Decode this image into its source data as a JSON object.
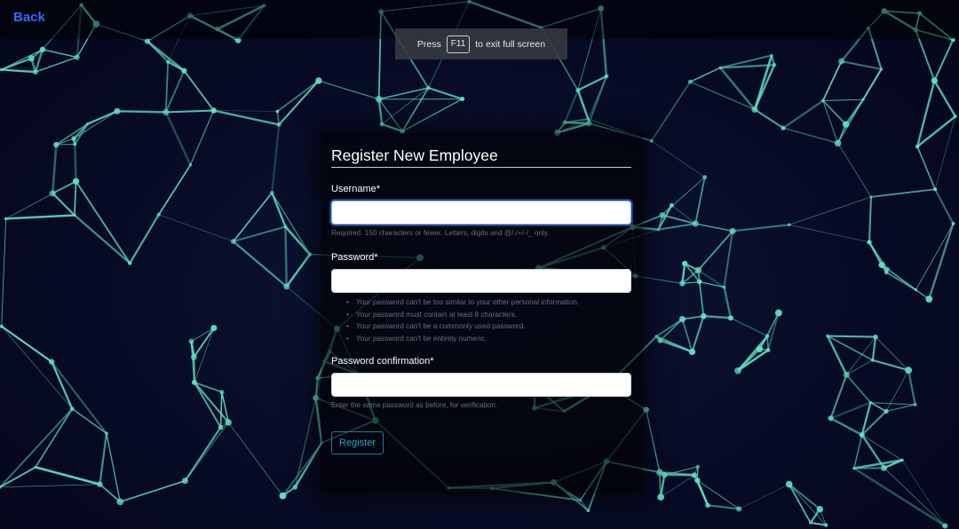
{
  "topbar": {
    "back_label": "Back"
  },
  "fullscreen_notice": {
    "prefix": "Press",
    "key": "F11",
    "suffix": "to exit full screen"
  },
  "form": {
    "title": "Register New Employee",
    "username": {
      "label": "Username*",
      "value": "",
      "help": "Required. 150 characters or fewer. Letters, digits and @/./+/-/_ only."
    },
    "password": {
      "label": "Password*",
      "value": "",
      "help_items": [
        "Your password can't be too similar to your other personal information.",
        "Your password must contain at least 8 characters.",
        "Your password can't be a commonly used password.",
        "Your password can't be entirely numeric."
      ]
    },
    "password_confirmation": {
      "label": "Password confirmation*",
      "value": "",
      "help": "Enter the same password as before, for verification."
    },
    "submit_label": "Register"
  },
  "colors": {
    "background": "#070a22",
    "network_line": "#5fe0c0",
    "link": "#2f6ff0",
    "button_accent": "#1e7f8f"
  }
}
